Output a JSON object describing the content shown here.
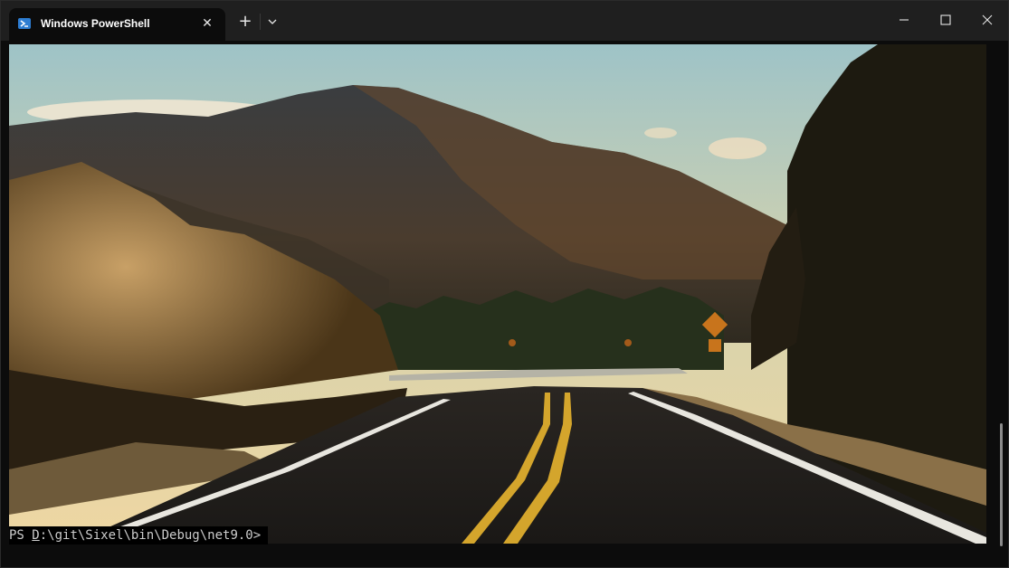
{
  "tab": {
    "title": "Windows PowerShell",
    "icon": "powershell-icon",
    "close_glyph": "✕"
  },
  "toolbar": {
    "new_tab_glyph": "+",
    "dropdown_icon": "chevron-down-icon"
  },
  "window_controls": {
    "minimize_icon": "minimize-icon",
    "maximize_icon": "maximize-icon",
    "close_icon": "close-icon"
  },
  "terminal": {
    "prompt_prefix": "PS ",
    "prompt_path_first": "D",
    "prompt_path_rest": ":\\git\\Sixel\\bin\\Debug\\net9.0>"
  },
  "colors": {
    "titlebar": "#1f1f1f",
    "terminal_bg": "#0c0c0c",
    "text": "#cccccc",
    "accent": "#2d7dd2"
  }
}
